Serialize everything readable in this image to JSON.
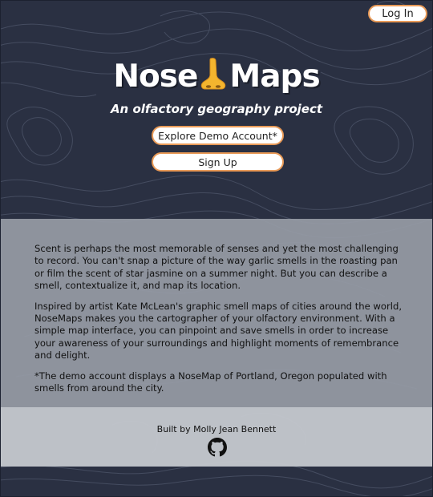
{
  "header": {
    "login_label": "Log In",
    "logo_word_1": "Nose",
    "logo_word_2": "Maps",
    "logo_icon": "nose-emoji-icon",
    "tagline": "An olfactory geography project",
    "demo_button_label": "Explore Demo Account*",
    "signup_button_label": "Sign Up"
  },
  "about": {
    "paragraphs": [
      "Scent is perhaps the most memorable of senses and yet the most challenging to record. You can't snap a picture of the way garlic smells in the roasting pan or film the scent of star jasmine on a summer night. But you can describe a smell, contextualize it, and map its location.",
      "Inspired by artist Kate McLean's graphic smell maps of cities around the world, NoseMaps makes you the cartographer of your olfactory environment. With a simple map interface, you can pinpoint and save smells in order to increase your awareness of your surroundings and highlight moments of remembrance and delight.",
      "*The demo account displays a NoseMap of Portland, Oregon populated with smells from around the city."
    ]
  },
  "footer": {
    "credit": "Built by Molly Jean Bennett",
    "github_icon": "github-icon"
  },
  "colors": {
    "background": "#2a3042",
    "topo_lines": "#4a5266",
    "button_border": "#e99a57",
    "about_panel": "#969ba5",
    "footer_panel": "#c4c7cd"
  }
}
